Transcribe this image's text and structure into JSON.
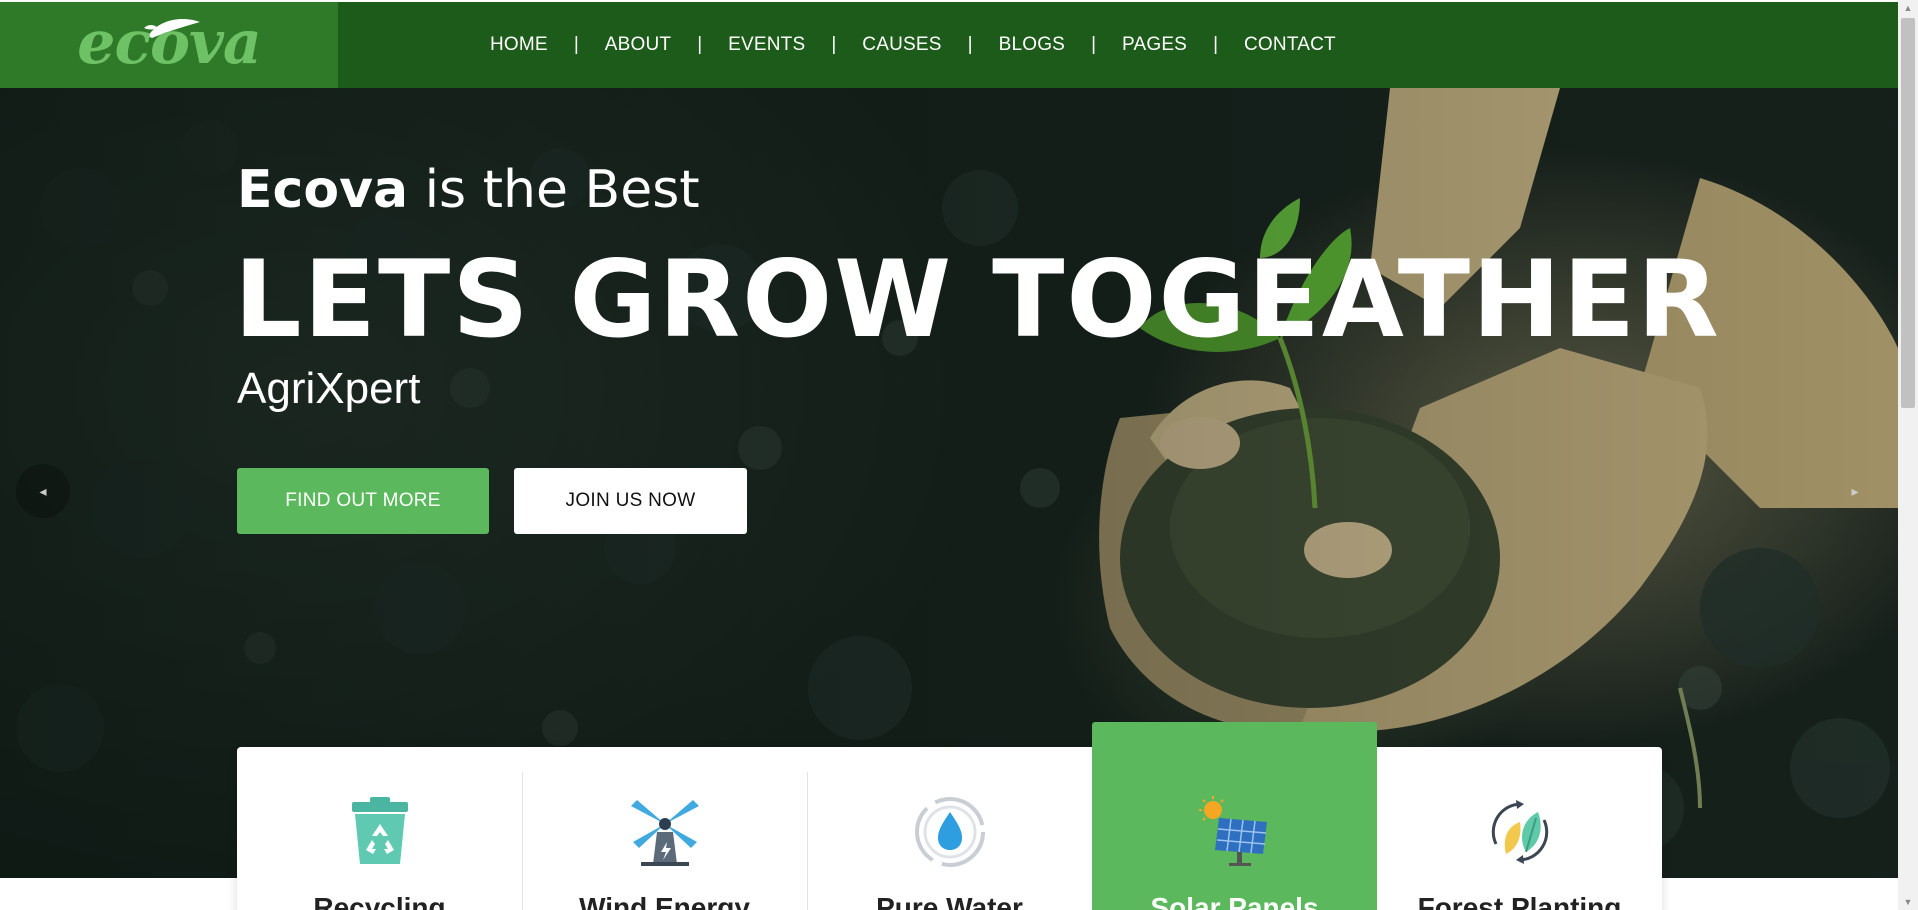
{
  "header": {
    "logo_text": "ecova",
    "nav": [
      {
        "label": "HOME"
      },
      {
        "label": "ABOUT"
      },
      {
        "label": "EVENTS"
      },
      {
        "label": "CAUSES"
      },
      {
        "label": "BLOGS"
      },
      {
        "label": "PAGES"
      },
      {
        "label": "CONTACT"
      }
    ],
    "separator": "|"
  },
  "hero": {
    "subtitle_bold": "Ecova",
    "subtitle_rest": " is the Best",
    "title": "LETS GROW TOGEATHER",
    "brand": "AgriXpert",
    "primary_button": "FIND OUT MORE",
    "secondary_button": "JOIN US NOW",
    "arrow_left": "◂",
    "arrow_right": "▸"
  },
  "services": [
    {
      "label": "Recycling",
      "icon": "recycle-bin-icon",
      "active": false
    },
    {
      "label": "Wind Energy",
      "icon": "windmill-icon",
      "active": false
    },
    {
      "label": "Pure Water",
      "icon": "water-drop-icon",
      "active": false
    },
    {
      "label": "Solar Panels",
      "icon": "solar-panel-icon",
      "active": true
    },
    {
      "label": "Forest Planting",
      "icon": "leaf-cycle-icon",
      "active": false
    }
  ],
  "colors": {
    "header_bg": "#1d5b1a",
    "logo_bg": "#2f7a29",
    "accent": "#5cb85c"
  }
}
